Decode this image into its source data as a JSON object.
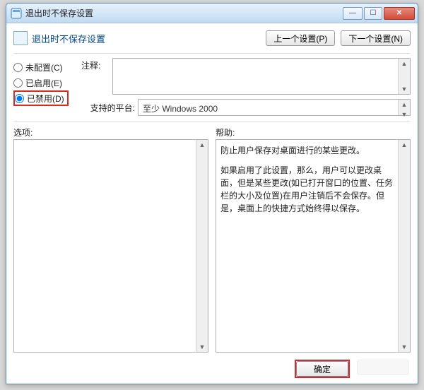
{
  "window": {
    "title": "退出时不保存设置"
  },
  "header": {
    "title": "退出时不保存设置",
    "prev": "上一个设置(P)",
    "next": "下一个设置(N)"
  },
  "radios": {
    "notConfigured": "未配置(C)",
    "enabled": "已启用(E)",
    "disabled": "已禁用(D)",
    "selected": "disabled"
  },
  "comment": {
    "label": "注释:"
  },
  "platform": {
    "label": "支持的平台:",
    "value": "至少 Windows 2000"
  },
  "panels": {
    "options": "选项:",
    "help": "帮助:"
  },
  "helpText": {
    "p1": "防止用户保存对桌面进行的某些更改。",
    "p2": "如果启用了此设置，那么，用户可以更改桌面，但是某些更改(如已打开窗口的位置、任务栏的大小及位置)在用户注销后不会保存。但是，桌面上的快捷方式始终得以保存。"
  },
  "footer": {
    "ok": "确定"
  }
}
